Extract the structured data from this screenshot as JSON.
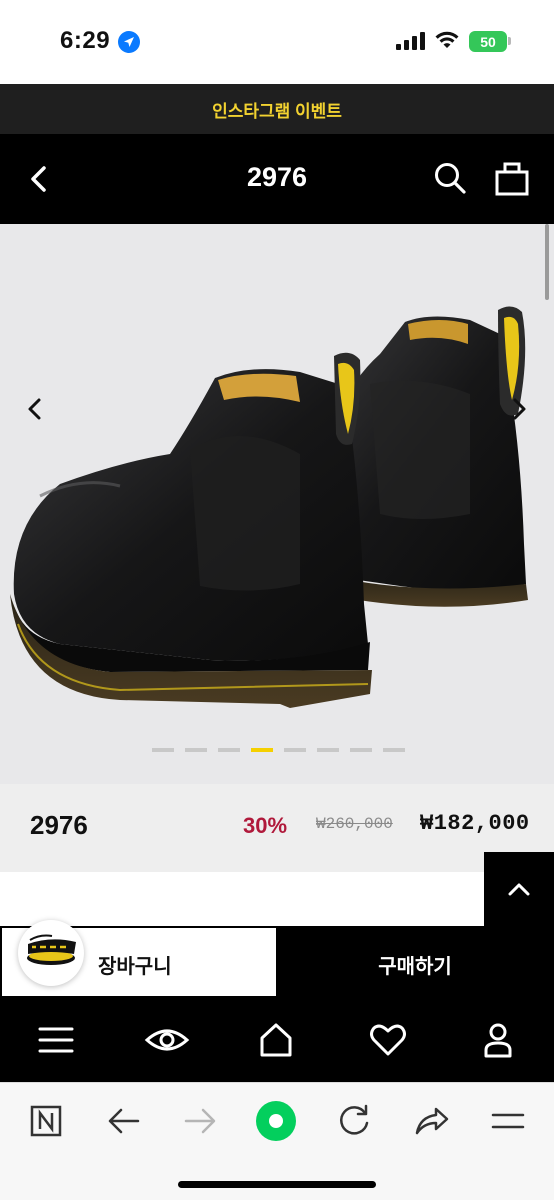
{
  "status_bar": {
    "time": "6:29",
    "battery": "50",
    "icons": [
      "location-arrow-icon",
      "signal-bars-icon",
      "wifi-icon",
      "battery-icon"
    ]
  },
  "event_banner": {
    "text": "인스타그램 이벤트",
    "color": "#f2d230"
  },
  "header": {
    "title": "2976",
    "icons": [
      "chevron-left-icon",
      "search-icon",
      "shopping-bag-icon"
    ]
  },
  "gallery": {
    "image_alt": "Black Chelsea boots",
    "page_count": 8,
    "active_index": 3,
    "icons": [
      "chevron-left-icon",
      "chevron-right-icon"
    ]
  },
  "product": {
    "name": "2976",
    "discount": "30%",
    "original_price": "₩260,000",
    "sale_price": "₩182,000"
  },
  "actions": {
    "cart_label": "장바구니",
    "buy_label": "구매하기",
    "brand_logo": "Dr. Martens"
  },
  "bottom_nav": {
    "items": [
      "menu-icon",
      "eye-icon",
      "home-icon",
      "heart-icon",
      "user-icon"
    ]
  },
  "browser_toolbar": {
    "items": [
      "naver-n-icon",
      "back-arrow-icon",
      "forward-arrow-icon",
      "green-dot-icon",
      "refresh-icon",
      "share-icon",
      "menu-icon"
    ]
  },
  "colors": {
    "accent_yellow": "#f5d000",
    "discount_red": "#b0193b",
    "header_black": "#000000"
  }
}
